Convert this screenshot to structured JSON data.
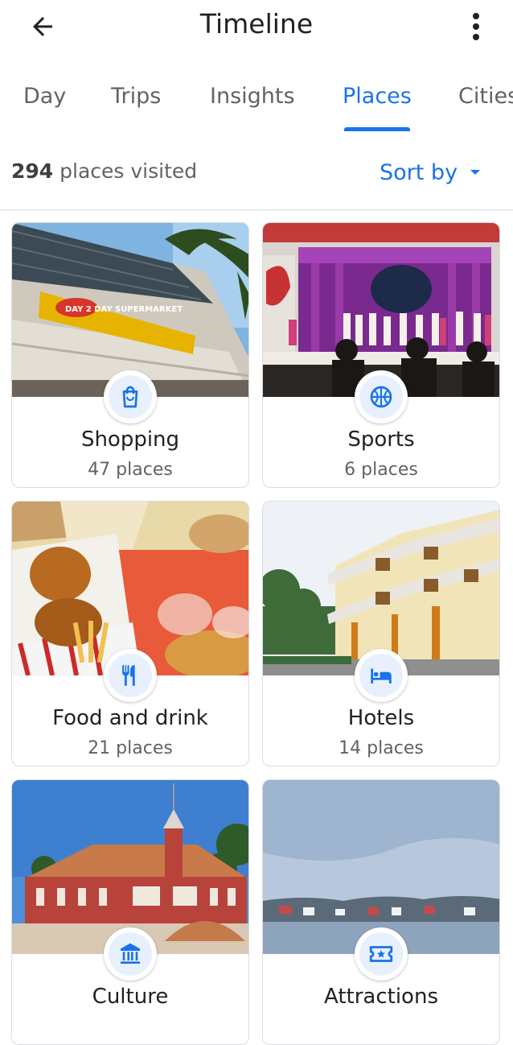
{
  "appbar": {
    "title": "Timeline"
  },
  "tabs": [
    "Day",
    "Trips",
    "Insights",
    "Places",
    "Cities"
  ],
  "active_tab": "Places",
  "summary": {
    "count": "294",
    "label": "places visited"
  },
  "sort": {
    "label": "Sort by"
  },
  "colors": {
    "accent": "#1a73e8",
    "icon_bg": "#e8f0fe",
    "divider": "#e8eaed"
  },
  "categories": [
    {
      "name": "Shopping",
      "count": "47 places",
      "icon": "shopping-bag-icon"
    },
    {
      "name": "Sports",
      "count": "6 places",
      "icon": "basketball-icon"
    },
    {
      "name": "Food and drink",
      "count": "21 places",
      "icon": "restaurant-icon"
    },
    {
      "name": "Hotels",
      "count": "14 places",
      "icon": "hotel-bed-icon"
    },
    {
      "name": "Culture",
      "count": "",
      "icon": "museum-icon"
    },
    {
      "name": "Attractions",
      "count": "",
      "icon": "ticket-icon"
    }
  ],
  "photos": {
    "shopping_sign": "DAY 2 DAY SUPERMARKET"
  }
}
